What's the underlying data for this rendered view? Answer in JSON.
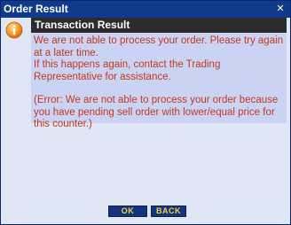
{
  "window": {
    "title": "Order Result",
    "close_glyph": "✕"
  },
  "panel": {
    "header": "Transaction Result",
    "message_line1": "We are not able to process your order. Please try again at a later time.",
    "message_line2": "If this happens again, contact the Trading Representative for assistance.",
    "error_text": "(Error: We are not able to process your order because you have pending sell order with lower/equal price for this counter.)",
    "icon": "info-icon",
    "text_color": "#c0391d"
  },
  "buttons": {
    "ok_label": "OK",
    "back_label": "BACK"
  }
}
